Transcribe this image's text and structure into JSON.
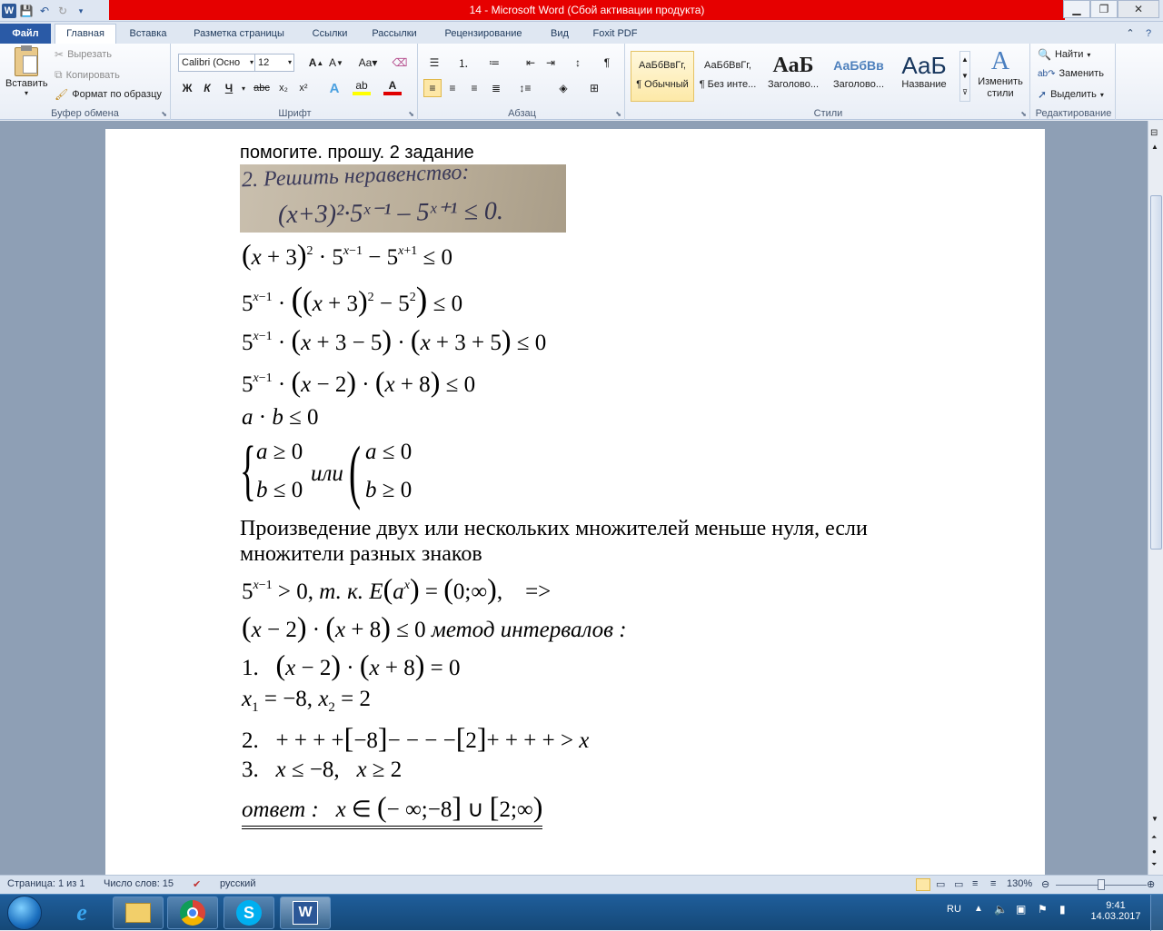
{
  "window": {
    "title": "14 - Microsoft Word (Сбой активации продукта)"
  },
  "tabs": [
    "Файл",
    "Главная",
    "Вставка",
    "Разметка страницы",
    "Ссылки",
    "Рассылки",
    "Рецензирование",
    "Вид",
    "Foxit PDF"
  ],
  "clipboard": {
    "paste": "Вставить",
    "cut": "Вырезать",
    "copy": "Копировать",
    "format_painter": "Формат по образцу",
    "label": "Буфер обмена"
  },
  "font": {
    "name": "Calibri (Осно",
    "size": "12",
    "label": "Шрифт"
  },
  "paragraph": {
    "label": "Абзац"
  },
  "styles": {
    "items": [
      {
        "preview": "АаБбВвГг,",
        "name": "¶ Обычный"
      },
      {
        "preview": "АаБбВвГг,",
        "name": "¶ Без инте..."
      },
      {
        "preview": "АаБ",
        "name": "Заголово..."
      },
      {
        "preview": "АаБбВв",
        "name": "Заголово..."
      },
      {
        "preview": "АаБ",
        "name": "Название"
      }
    ],
    "change": "Изменить стили",
    "label": "Стили"
  },
  "editing": {
    "find": "Найти",
    "replace": "Заменить",
    "select": "Выделить",
    "label": "Редактирование"
  },
  "document": {
    "heading": "помогите. прошу. 2 задание",
    "photo_lines": [
      "2. Решить неравенство:",
      "(x+3)²·5ˣ⁻¹ – 5ˣ⁺¹ ≤ 0."
    ],
    "para1": "Произведение двух или нескольких множителей меньше нуля, если",
    "para2": "множители разных знаков",
    "eq_system_or": "или",
    "eq_method": "метод интервалов :",
    "eq_answer_label": "ответ :",
    "eq_tk": "т. к."
  },
  "status": {
    "page": "Страница: 1 из 1",
    "words": "Число слов: 15",
    "lang": "русский",
    "zoom": "130%"
  },
  "taskbar": {
    "lang": "RU",
    "time": "9:41",
    "date": "14.03.2017"
  }
}
